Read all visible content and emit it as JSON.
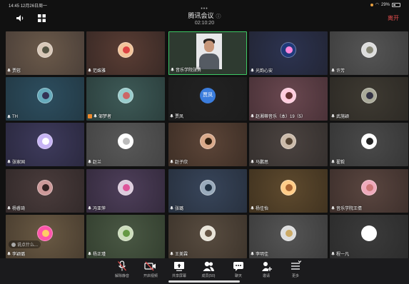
{
  "status_bar": {
    "time": "14:45",
    "date": "12月26日周一",
    "battery": "29%"
  },
  "header": {
    "title": "腾讯会议",
    "info_icon": "info-icon",
    "duration": "02:10:20",
    "leave_label": "离开",
    "more_dots": "•••"
  },
  "participants": [
    {
      "name": "贾慰",
      "colors": [
        "#6b5a4a",
        "#4c4039"
      ],
      "avatar": [
        "#d8c8b8",
        "#554"
      ]
    },
    {
      "name": "范姝雅",
      "colors": [
        "#5a3d34",
        "#3a2a26"
      ],
      "avatar": [
        "#f2c39a",
        "#d44"
      ]
    },
    {
      "name": "音乐学院张勇",
      "video": true,
      "active": true
    },
    {
      "name": "光韵心安",
      "colors": [
        "#2c3350",
        "#232636"
      ],
      "avatar": [
        "#1f3a7a",
        "#f8d"
      ]
    },
    {
      "name": "许芳",
      "colors": [
        "#555",
        "#3f3f3f"
      ],
      "avatar": [
        "#ddd",
        "#887"
      ]
    },
    {
      "name": "TH",
      "colors": [
        "#2d4e5f",
        "#233a46"
      ],
      "avatar": [
        "#6ab",
        "#335"
      ]
    },
    {
      "name": "邹梦者",
      "host": true,
      "colors": [
        "#3e5a57",
        "#2c403e"
      ],
      "avatar": [
        "#9cc",
        "#c66"
      ]
    },
    {
      "name": "贾凤",
      "text_avatar": "贾凤",
      "colors": [
        "#222",
        "#1c1c1c"
      ]
    },
    {
      "name": "赵湘蒂音乐（本）19（5）",
      "colors": [
        "#6a4850",
        "#4a3238"
      ],
      "avatar": [
        "#fcd",
        "#633"
      ]
    },
    {
      "name": "武施颖",
      "colors": [
        "#3e3a32",
        "#2d2a25"
      ],
      "avatar": [
        "#aa9",
        "#334"
      ]
    },
    {
      "name": "张家国",
      "colors": [
        "#3e3b5c",
        "#2b2940"
      ],
      "avatar": [
        "#c7b4f4",
        "#fff"
      ]
    },
    {
      "name": "赵兰",
      "colors": [
        "#585858",
        "#444"
      ],
      "avatar": [
        "#fff",
        "#bbb"
      ]
    },
    {
      "name": "赵子欣",
      "colors": [
        "#5c4538",
        "#3e2f26"
      ],
      "avatar": [
        "#d9a98a",
        "#321"
      ]
    },
    {
      "name": "马鹏思",
      "colors": [
        "#4b4340",
        "#35302e"
      ],
      "avatar": [
        "#cba",
        "#543"
      ]
    },
    {
      "name": "翟毅",
      "colors": [
        "#4a4a4a",
        "#363636"
      ],
      "avatar": [
        "#fff",
        "#222"
      ]
    },
    {
      "name": "杨睿琦",
      "colors": [
        "#4a3c3c",
        "#332a2a"
      ],
      "avatar": [
        "#c99",
        "#322"
      ]
    },
    {
      "name": "冯亚萍",
      "colors": [
        "#4e3f5a",
        "#352b3e"
      ],
      "avatar": [
        "#dcd",
        "#d59"
      ]
    },
    {
      "name": "张璐",
      "colors": [
        "#38455a",
        "#28313f"
      ],
      "avatar": [
        "#9ab",
        "#234"
      ]
    },
    {
      "name": "杨佳怡",
      "colors": [
        "#5e4a2e",
        "#413320"
      ],
      "avatar": [
        "#fc8",
        "#a63"
      ]
    },
    {
      "name": "音乐学院王倩",
      "colors": [
        "#5a4640",
        "#3e302c"
      ],
      "avatar": [
        "#eab",
        "#c77"
      ]
    },
    {
      "name": "李颖璐",
      "colors": [
        "#6a5a44",
        "#4a3e30"
      ],
      "avatar": [
        "#f5a",
        "#fc6"
      ],
      "chat_tip": "说点什么..."
    },
    {
      "name": "杨正瑾",
      "colors": [
        "#4a5844",
        "#344030"
      ],
      "avatar": [
        "#cdb",
        "#694"
      ]
    },
    {
      "name": "王美霖",
      "colors": [
        "#584c40",
        "#3e352c"
      ],
      "avatar": [
        "#e9e4d8",
        "#654"
      ]
    },
    {
      "name": "李明佳",
      "colors": [
        "#555",
        "#3d3d3d"
      ],
      "avatar": [
        "#ddd",
        "#ca6"
      ]
    },
    {
      "name": "程一凡",
      "white_avatar": true,
      "colors": [
        "#3b3b3b",
        "#2c2c2c"
      ]
    }
  ],
  "toolbar": [
    {
      "key": "mute",
      "label": "解除静音",
      "icon": "mic-off-icon"
    },
    {
      "key": "video",
      "label": "开启视频",
      "icon": "video-off-icon"
    },
    {
      "key": "share",
      "label": "共享屏幕",
      "icon": "share-screen-icon"
    },
    {
      "key": "members",
      "label": "成员(50)",
      "icon": "members-icon"
    },
    {
      "key": "chat",
      "label": "聊天",
      "icon": "chat-icon"
    },
    {
      "key": "invite",
      "label": "邀请",
      "icon": "invite-icon"
    },
    {
      "key": "more",
      "label": "更多",
      "icon": "more-icon"
    }
  ]
}
